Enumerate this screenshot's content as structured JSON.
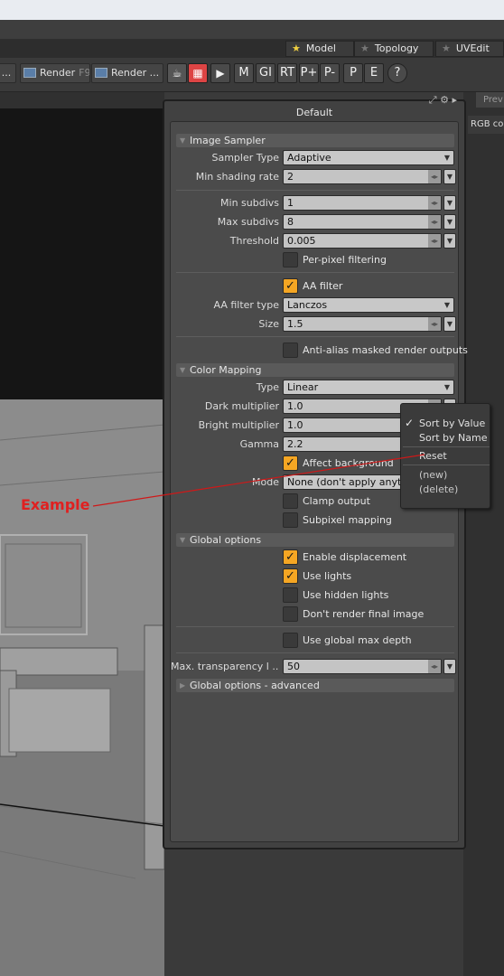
{
  "tabs": [
    {
      "label": "Model",
      "active": true
    },
    {
      "label": "Topology",
      "active": false
    },
    {
      "label": "UVEdit",
      "active": false
    }
  ],
  "toolbar": {
    "ellipsis": "...",
    "render_label": "Render",
    "render_key": "F9",
    "render2_label": "Render ...",
    "play_glyph": "▶",
    "m": "M",
    "gi": "GI",
    "rt": "RT",
    "pplus": "P+",
    "pminus": "P-",
    "p": "P",
    "e": "E",
    "help": "?"
  },
  "right": {
    "prev_tab": "Prev",
    "rgb_label": "RGB colo"
  },
  "panel": {
    "title": "Default",
    "sections": {
      "image_sampler": "Image Sampler",
      "color_mapping": "Color Mapping",
      "global_options": "Global options",
      "global_advanced": "Global options - advanced"
    },
    "sampler_type": {
      "label": "Sampler Type",
      "value": "Adaptive"
    },
    "min_shading_rate": {
      "label": "Min shading rate",
      "value": "2"
    },
    "min_subdivs": {
      "label": "Min subdivs",
      "value": "1"
    },
    "max_subdivs": {
      "label": "Max subdivs",
      "value": "8"
    },
    "threshold": {
      "label": "Threshold",
      "value": "0.005"
    },
    "per_pixel_filtering": {
      "label": "Per-pixel filtering",
      "checked": false
    },
    "aa_filter": {
      "label": "AA filter",
      "checked": true
    },
    "aa_filter_type": {
      "label": "AA filter type",
      "value": "Lanczos"
    },
    "size": {
      "label": "Size",
      "value": "1.5"
    },
    "antialias_masked": {
      "label": "Anti-alias masked render outputs",
      "checked": false
    },
    "cm_type": {
      "label": "Type",
      "value": "Linear"
    },
    "dark_multiplier": {
      "label": "Dark multiplier",
      "value": "1.0"
    },
    "bright_multiplier": {
      "label": "Bright multiplier",
      "value": "1.0"
    },
    "gamma": {
      "label": "Gamma",
      "value": "2.2"
    },
    "affect_background": {
      "label": "Affect background",
      "checked": true
    },
    "mode": {
      "label": "Mode",
      "value": "None (don't apply anything)"
    },
    "clamp_output": {
      "label": "Clamp output",
      "checked": false
    },
    "subpixel_mapping": {
      "label": "Subpixel mapping",
      "checked": false
    },
    "enable_displacement": {
      "label": "Enable displacement",
      "checked": true
    },
    "use_lights": {
      "label": "Use lights",
      "checked": true
    },
    "use_hidden_lights": {
      "label": "Use hidden lights",
      "checked": false
    },
    "dont_render_final": {
      "label": "Don't render final image",
      "checked": false
    },
    "use_global_max_depth": {
      "label": "Use global max depth",
      "checked": false
    },
    "max_transparency": {
      "label": "Max. transparency l ...",
      "value": "50"
    }
  },
  "context_menu": {
    "sort_by_value": "Sort by Value",
    "sort_by_name": "Sort by Name",
    "reset": "Reset",
    "new": "(new)",
    "delete": "(delete)"
  },
  "annotation": {
    "label": "Example",
    "color": "#e02020"
  },
  "colors": {
    "accent_checkbox": "#f5a623",
    "panel_bg": "#414141",
    "field_bg": "#c4c4c4"
  }
}
